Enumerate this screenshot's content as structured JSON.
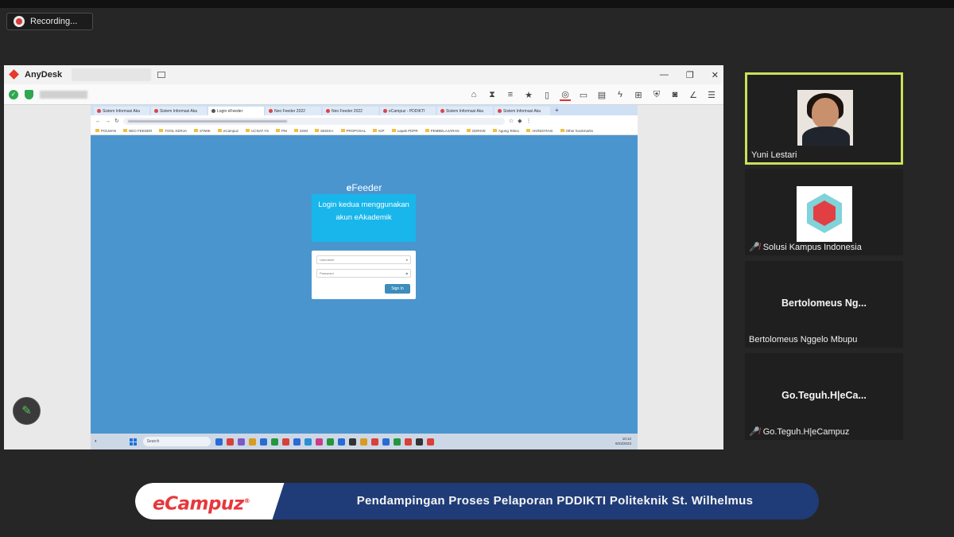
{
  "recording": {
    "label": "Recording..."
  },
  "anydesk": {
    "app_name": "AnyDesk",
    "window_buttons": [
      "—",
      "❐",
      "✕"
    ]
  },
  "remote_browser": {
    "tabs": [
      "Sistem Informasi Aka",
      "Sistem Informasi Aka",
      "Login eFeeder",
      "Neo Feeder 2022",
      "Neo Feeder 2022",
      "eCampuz - PDDIKTI",
      "Sistem Informasi Aka",
      "Sistem Informasi Aka"
    ],
    "bookmarks": [
      "POLMAN",
      "NEO FEEDER",
      "TOOL KERJA",
      "STMIK",
      "eCampuz",
      "UCNAT.YS",
      "PM",
      "SGM",
      "SEDIKA",
      "PROPOSAL",
      "KIP",
      "Lapak PDPR",
      "PEMBELAJARAN",
      "GDRIVE",
      "Agung Tekno",
      "AKREDITASI",
      "Other bookmarks"
    ]
  },
  "efeeder": {
    "title_prefix": "e",
    "title_rest": "Feeder",
    "info_text": "Login kedua menggunakan akun eAkademik",
    "username_placeholder": "Username",
    "password_placeholder": "Password",
    "signin_label": "Sign In"
  },
  "remote_taskbar": {
    "search_label": "Search",
    "time": "10:12",
    "date": "9/23/2023"
  },
  "participants": [
    {
      "name": "Yuni Lestari",
      "muted": false,
      "active": true
    },
    {
      "name": "Solusi Kampus Indonesia",
      "muted": true,
      "active": false
    },
    {
      "name": "Bertolomeus Nggelo Mbupu",
      "display_short": "Bertolomeus  Ng...",
      "muted": false,
      "active": false
    },
    {
      "name": "Go.Teguh.H|eCampuz",
      "display_short": "Go.Teguh.H|eCa...",
      "muted": true,
      "active": false
    }
  ],
  "banner": {
    "logo_text": "eCampuz",
    "logo_mark": "®",
    "title": "Pendampingan Proses Pelaporan PDDIKTI Politeknik St. Wilhelmus"
  },
  "colors": {
    "active_speaker_border": "#c8e15a",
    "remote_background": "#4b95cf",
    "efeeder_box": "#18b6ea",
    "banner_blue": "#1f3c78",
    "brand_red": "#e8373c"
  }
}
